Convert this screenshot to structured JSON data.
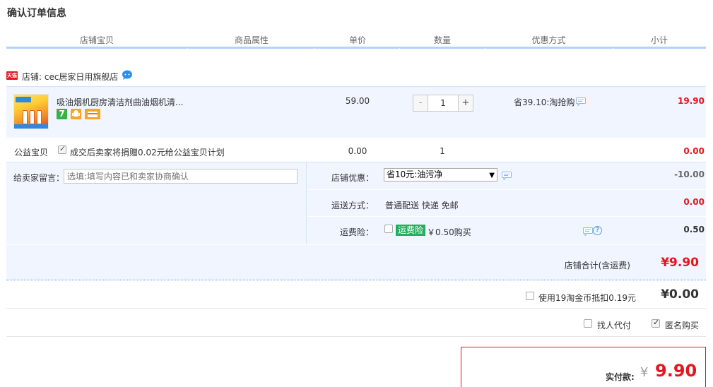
{
  "page": {
    "title": "确认订单信息"
  },
  "columns": [
    "店铺宝贝",
    "商品属性",
    "单价",
    "数量",
    "优惠方式",
    "小计"
  ],
  "shop": {
    "badge": "天猫",
    "label": "店铺: cec居家日用旗舰店",
    "icon": "chat-bubble-icon"
  },
  "item": {
    "title": "吸油烟机厨房清洁剂曲油烟机清...",
    "service_icons": [
      "seven-day-return-icon",
      "android-icon",
      "card-icon"
    ],
    "price": "59.00",
    "quantity": "1",
    "decrement_label": "-",
    "increment_label": "+",
    "promo": "省39.10:淘抢购",
    "subtotal": "19.90"
  },
  "charity": {
    "label": "公益宝贝",
    "checked": true,
    "text": "成交后卖家将捐赠0.02元给公益宝贝计划",
    "price": "0.00",
    "quantity": "1",
    "subtotal": "0.00"
  },
  "message": {
    "label": "给卖家留言：",
    "placeholder": "选填:填写内容已和卖家协商确认"
  },
  "shop_discount": {
    "label": "店铺优惠：",
    "selected": "省10元:油污净",
    "amount": "-10.00"
  },
  "shipping": {
    "label": "运送方式：",
    "value": "普通配送 快递 免邮",
    "amount": "0.00"
  },
  "insurance": {
    "label": "运费险：",
    "checked": false,
    "badge": "运费险",
    "text": "￥0.50购买",
    "amount": "0.50"
  },
  "shop_total": {
    "label": "店铺合计(含运费)",
    "amount": "¥9.90"
  },
  "coins": {
    "checked": false,
    "text": "使用19淘金币抵扣0.19元",
    "amount": "¥0.00"
  },
  "options": {
    "proxy_pay": "找人代付",
    "proxy_checked": false,
    "anonymous": "匿名购买",
    "anonymous_checked": true
  },
  "payment": {
    "label": "实付款:",
    "currency": "¥",
    "amount": "9.90"
  },
  "colors": {
    "accent_red": "#e4161e",
    "header_rule": "#b2d1ff",
    "band": "#f0f5ff",
    "insurance_green": "#20b060"
  }
}
